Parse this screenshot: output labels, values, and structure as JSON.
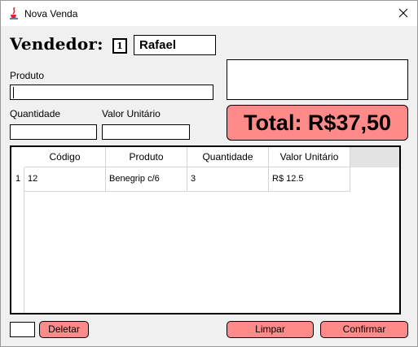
{
  "window": {
    "title": "Nova Venda",
    "icon": "java-cup-icon",
    "accent": "#ff8a8a"
  },
  "vendedor": {
    "label": "Vendedor:",
    "id": "1",
    "name": "Rafael"
  },
  "produto": {
    "label": "Produto",
    "value": ""
  },
  "quantidade": {
    "label": "Quantidade",
    "value": ""
  },
  "valor_unitario": {
    "label": "Valor Unitário",
    "value": ""
  },
  "total": {
    "text": "Total: R$37,50"
  },
  "table": {
    "columns": [
      "Código",
      "Produto",
      "Quantidade",
      "Valor Unitário"
    ],
    "rows": [
      {
        "index": "1",
        "cells": [
          "12",
          "Benegrip c/6",
          "3",
          "R$ 12.5"
        ]
      }
    ]
  },
  "footer": {
    "small_input_value": "",
    "delete_label": "Deletar",
    "clear_label": "Limpar",
    "confirm_label": "Confirmar"
  }
}
